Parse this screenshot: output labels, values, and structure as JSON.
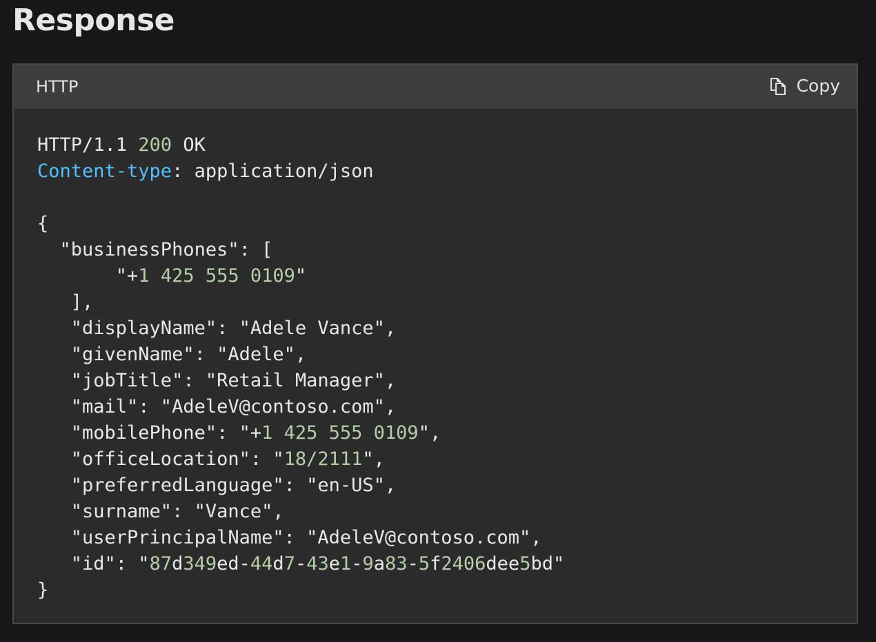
{
  "section": {
    "heading": "Response"
  },
  "code_block": {
    "language": "HTTP",
    "copy_label": "Copy",
    "copy_icon": "copy-icon",
    "colors": {
      "background": "#2b2b2b",
      "header_background": "#3d3d3d",
      "text": "#e8e8e8",
      "number": "#b5cea8",
      "header_name": "#4fc1ff"
    },
    "lines": [
      [
        {
          "t": "HTTP/1.1 "
        },
        {
          "t": "200",
          "c": "num"
        },
        {
          "t": " OK"
        }
      ],
      [
        {
          "t": "Content-type",
          "c": "hdr"
        },
        {
          "t": ": application/json"
        }
      ],
      [],
      [
        {
          "t": "{"
        }
      ],
      [
        {
          "t": "  \"businessPhones\": ["
        }
      ],
      [
        {
          "t": "       \"+"
        },
        {
          "t": "1 425 555 0109",
          "c": "num"
        },
        {
          "t": "\""
        }
      ],
      [
        {
          "t": "   ],"
        }
      ],
      [
        {
          "t": "   \"displayName\": \"Adele Vance\","
        }
      ],
      [
        {
          "t": "   \"givenName\": \"Adele\","
        }
      ],
      [
        {
          "t": "   \"jobTitle\": \"Retail Manager\","
        }
      ],
      [
        {
          "t": "   \"mail\": \"AdeleV@contoso.com\","
        }
      ],
      [
        {
          "t": "   \"mobilePhone\": \"+"
        },
        {
          "t": "1 425 555 0109",
          "c": "num"
        },
        {
          "t": "\","
        }
      ],
      [
        {
          "t": "   \"officeLocation\": \""
        },
        {
          "t": "18/2111",
          "c": "num"
        },
        {
          "t": "\","
        }
      ],
      [
        {
          "t": "   \"preferredLanguage\": \"en-US\","
        }
      ],
      [
        {
          "t": "   \"surname\": \"Vance\","
        }
      ],
      [
        {
          "t": "   \"userPrincipalName\": \"AdeleV@contoso.com\","
        }
      ],
      [
        {
          "t": "   \"id\": \""
        },
        {
          "t": "87",
          "c": "num"
        },
        {
          "t": "d"
        },
        {
          "t": "349",
          "c": "num"
        },
        {
          "t": "ed-"
        },
        {
          "t": "44",
          "c": "num"
        },
        {
          "t": "d"
        },
        {
          "t": "7",
          "c": "num"
        },
        {
          "t": "-"
        },
        {
          "t": "43",
          "c": "num"
        },
        {
          "t": "e"
        },
        {
          "t": "1",
          "c": "num"
        },
        {
          "t": "-"
        },
        {
          "t": "9",
          "c": "num"
        },
        {
          "t": "a"
        },
        {
          "t": "83",
          "c": "num"
        },
        {
          "t": "-"
        },
        {
          "t": "5",
          "c": "num"
        },
        {
          "t": "f"
        },
        {
          "t": "2406",
          "c": "num"
        },
        {
          "t": "dee"
        },
        {
          "t": "5",
          "c": "num"
        },
        {
          "t": "bd\""
        }
      ],
      [
        {
          "t": "}"
        }
      ]
    ]
  }
}
